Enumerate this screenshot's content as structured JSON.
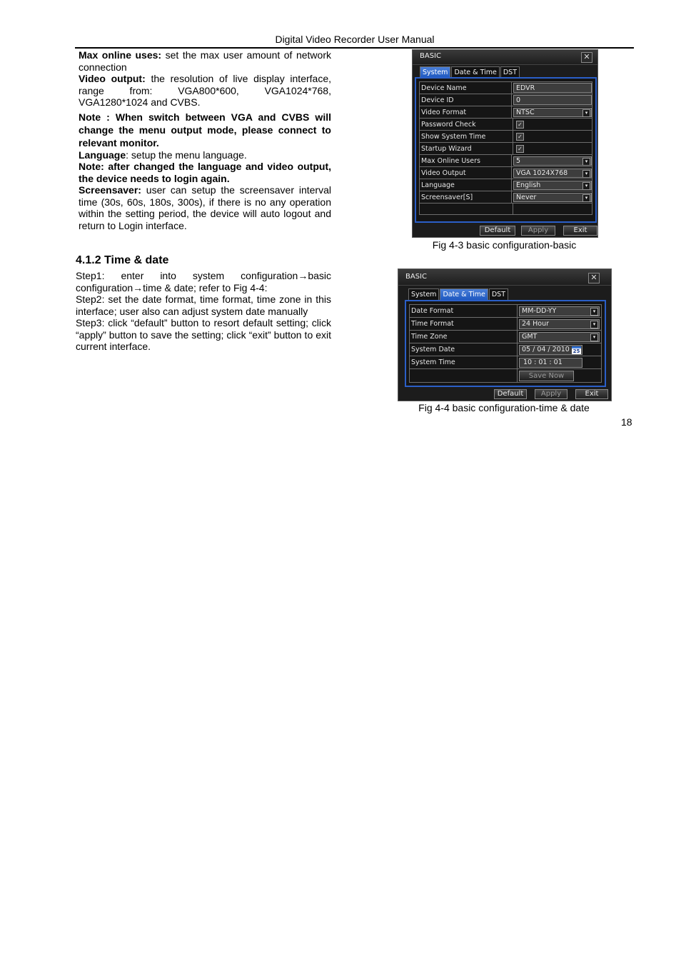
{
  "header": {
    "title": "Digital Video Recorder User Manual"
  },
  "left_column": {
    "paragraphs": [
      {
        "label": "Max online uses:",
        "text": " set the max user amount of network connection"
      },
      {
        "label": "Video output:",
        "text": " the resolution of live display interface, range from: VGA800*600, VGA1024*768, VGA1280*1024 and CVBS."
      },
      {
        "note": "Note :  When switch between VGA and CVBS will change the menu output mode, please connect to relevant monitor."
      },
      {
        "label": "Language",
        "text": ": setup the menu language."
      },
      {
        "note": "Note: after changed the language and video output, the device needs to login again."
      },
      {
        "label": "Screensaver:",
        "text": " user can setup the screensaver interval time (30s, 60s, 180s, 300s), if there is no any operation within the setting period, the device will auto logout and return to Login interface."
      }
    ]
  },
  "section": {
    "title": "4.1.2  Time & date",
    "steps": [
      "Step1: enter into system configuration→basic configuration→time & date; refer to Fig 4-4:",
      "Step2: set the date format, time format, time zone in this interface; user also can adjust system date manually",
      "Step3: click “default” button to resort default setting; click “apply” button to save the setting; click “exit” button to exit current interface."
    ]
  },
  "fig1": {
    "dialog_title": "BASIC",
    "close_icon": "close-x-icon",
    "tabs": [
      {
        "label": "System",
        "active": true
      },
      {
        "label": "Date & Time",
        "active": false
      },
      {
        "label": "DST",
        "active": false
      }
    ],
    "rows": [
      {
        "label": "Device Name",
        "type": "text",
        "value": "EDVR"
      },
      {
        "label": "Device ID",
        "type": "text",
        "value": "0"
      },
      {
        "label": "Video Format",
        "type": "select",
        "value": "NTSC"
      },
      {
        "label": "Password Check",
        "type": "checkbox",
        "checked": true
      },
      {
        "label": "Show System Time",
        "type": "checkbox",
        "checked": true
      },
      {
        "label": "Startup Wizard",
        "type": "checkbox",
        "checked": true
      },
      {
        "label": "Max Online Users",
        "type": "select",
        "value": "5"
      },
      {
        "label": "Video Output",
        "type": "select",
        "value": "VGA 1024X768"
      },
      {
        "label": "Language",
        "type": "select",
        "value": "English"
      },
      {
        "label": "Screensaver[S]",
        "type": "select",
        "value": "Never"
      },
      {
        "label": "",
        "type": "empty"
      }
    ],
    "buttons": {
      "default": "Default",
      "apply": "Apply",
      "exit": "Exit"
    },
    "caption": "Fig 4-3 basic configuration-basic"
  },
  "fig2": {
    "dialog_title": "BASIC",
    "close_icon": "close-x-icon",
    "tabs": [
      {
        "label": "System",
        "active": false
      },
      {
        "label": "Date & Time",
        "active": true
      },
      {
        "label": "DST",
        "active": false
      }
    ],
    "rows": [
      {
        "label": "Date Format",
        "type": "select",
        "value": "MM-DD-YY"
      },
      {
        "label": "Time Format",
        "type": "select",
        "value": "24 Hour"
      },
      {
        "label": "Time Zone",
        "type": "select",
        "value": "GMT"
      },
      {
        "label": "System Date",
        "type": "date",
        "value": "05 / 04 / 2010",
        "calendar_day": "25"
      },
      {
        "label": "System Time",
        "type": "time",
        "value": "10  :  01  :  01"
      },
      {
        "label": "",
        "type": "button",
        "value": "Save Now"
      }
    ],
    "buttons": {
      "default": "Default",
      "apply": "Apply",
      "exit": "Exit"
    },
    "caption": "Fig 4-4 basic configuration-time & date"
  },
  "page_number": "18",
  "colors": {
    "dialog_bg": "#1c1c1c",
    "accent_blue": "#2b5fc8",
    "tab_active": "#1e58c0"
  }
}
